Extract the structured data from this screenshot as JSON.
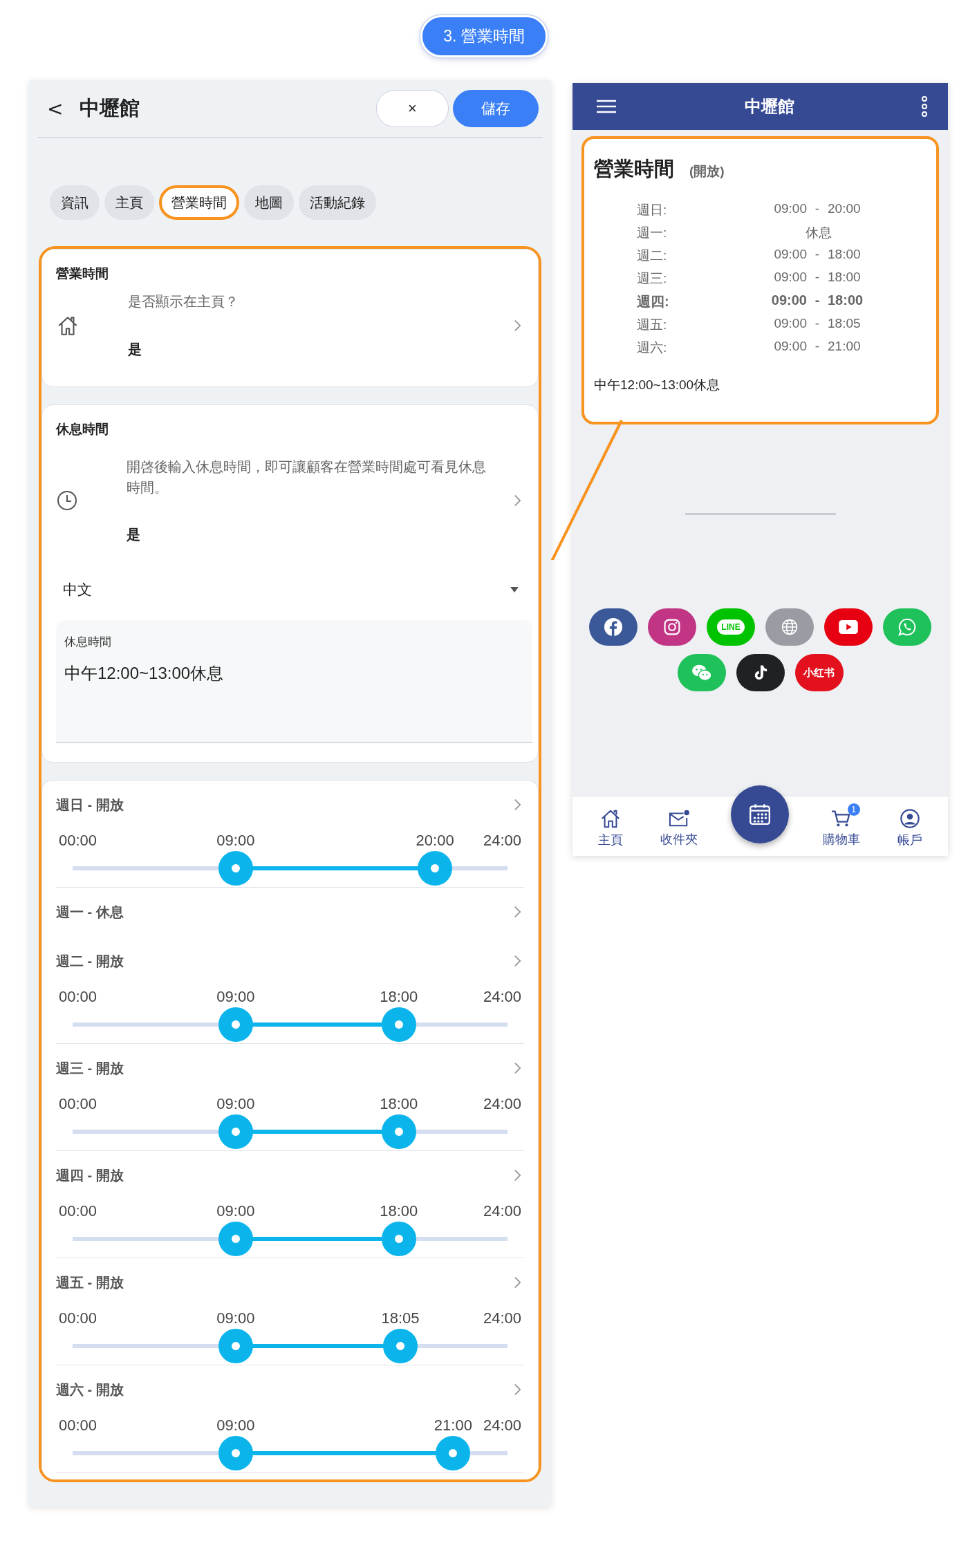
{
  "step_label": "3. 營業時間",
  "editor": {
    "back": "<",
    "title": "中壢館",
    "close": "×",
    "save": "儲存",
    "tabs": [
      {
        "label": "資訊",
        "selected": false
      },
      {
        "label": "主頁",
        "selected": false
      },
      {
        "label": "營業時間",
        "selected": true
      },
      {
        "label": "地圖",
        "selected": false
      },
      {
        "label": "活動紀錄",
        "selected": false
      }
    ],
    "show_section": {
      "title": "營業時間",
      "question": "是否顯示在主頁？",
      "value": "是"
    },
    "break_section": {
      "title": "休息時間",
      "description": "開啓後輸入休息時間，即可讓顧客在營業時間處可看見休息時間。",
      "value": "是",
      "language": "中文",
      "field_label": "休息時間",
      "field_value": "中午12:00~13:00休息"
    },
    "days": [
      {
        "label": "週日 - 開放",
        "open": true,
        "min": "00:00",
        "max": "24:00",
        "thumbs": [
          {
            "label": "09:00",
            "level": 0.375
          },
          {
            "label": "20:00",
            "level": 0.8333
          }
        ]
      },
      {
        "label": "週一 - 休息",
        "open": false
      },
      {
        "label": "週二 - 開放",
        "open": true,
        "min": "00:00",
        "max": "24:00",
        "thumbs": [
          {
            "label": "09:00",
            "level": 0.375
          },
          {
            "label": "18:00",
            "level": 0.75
          }
        ]
      },
      {
        "label": "週三 - 開放",
        "open": true,
        "min": "00:00",
        "max": "24:00",
        "thumbs": [
          {
            "label": "09:00",
            "level": 0.375
          },
          {
            "label": "18:00",
            "level": 0.75
          }
        ]
      },
      {
        "label": "週四 - 開放",
        "open": true,
        "min": "00:00",
        "max": "24:00",
        "thumbs": [
          {
            "label": "09:00",
            "level": 0.375
          },
          {
            "label": "18:00",
            "level": 0.75
          }
        ]
      },
      {
        "label": "週五 - 開放",
        "open": true,
        "min": "00:00",
        "max": "24:00",
        "thumbs": [
          {
            "label": "09:00",
            "level": 0.375
          },
          {
            "label": "18:05",
            "level": 0.7535
          }
        ]
      },
      {
        "label": "週六 - 開放",
        "open": true,
        "min": "00:00",
        "max": "24:00",
        "thumbs": [
          {
            "label": "09:00",
            "level": 0.375
          },
          {
            "label": "21:00",
            "level": 0.875
          }
        ]
      }
    ]
  },
  "preview": {
    "title": "中壢館",
    "card": {
      "title": "營業時間",
      "status": "(開放)",
      "rows": [
        {
          "day": "週日:",
          "open": "09:00",
          "dash": "-",
          "close": "20:00",
          "today": false
        },
        {
          "day": "週一:",
          "closed_text": "休息",
          "today": false
        },
        {
          "day": "週二:",
          "open": "09:00",
          "dash": "-",
          "close": "18:00",
          "today": false
        },
        {
          "day": "週三:",
          "open": "09:00",
          "dash": "-",
          "close": "18:00",
          "today": false
        },
        {
          "day": "週四:",
          "open": "09:00",
          "dash": "-",
          "close": "18:00",
          "today": true
        },
        {
          "day": "週五:",
          "open": "09:00",
          "dash": "-",
          "close": "18:05",
          "today": false
        },
        {
          "day": "週六:",
          "open": "09:00",
          "dash": "-",
          "close": "21:00",
          "today": false
        }
      ],
      "note": "中午12:00~13:00休息"
    },
    "social": [
      {
        "kind": "facebook",
        "color": "#3b5998"
      },
      {
        "kind": "instagram",
        "color": "#c13584"
      },
      {
        "kind": "line",
        "color": "#00c300",
        "label": "LINE"
      },
      {
        "kind": "web",
        "color": "#9a9ca3"
      },
      {
        "kind": "youtube",
        "color": "#e60012"
      },
      {
        "kind": "whatsapp",
        "color": "#1fc15a"
      },
      {
        "kind": "wechat",
        "color": "#1fc15a"
      },
      {
        "kind": "tiktok",
        "color": "#1f2125"
      },
      {
        "kind": "xiaohongshu",
        "color": "#e3101e",
        "label": "小红书"
      }
    ],
    "nav": [
      {
        "kind": "home",
        "label": "主頁"
      },
      {
        "kind": "inbox",
        "label": "收件夾"
      },
      {
        "kind": "calendar"
      },
      {
        "kind": "cart",
        "label": "購物車",
        "badge": "1"
      },
      {
        "kind": "account",
        "label": "帳戶"
      }
    ]
  }
}
